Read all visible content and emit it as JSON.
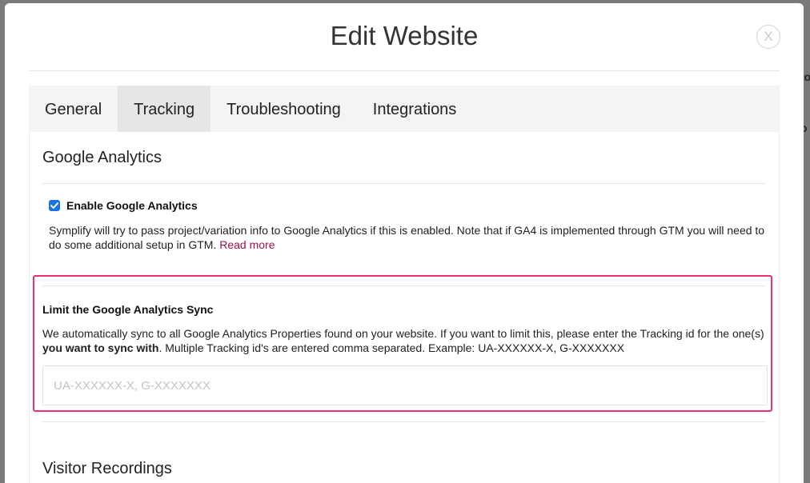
{
  "backdrop": {
    "partial_text_1": "to",
    "partial_text_2": "o"
  },
  "modal": {
    "title": "Edit Website",
    "close_label": "X"
  },
  "tabs": [
    {
      "label": "General",
      "active": false
    },
    {
      "label": "Tracking",
      "active": true
    },
    {
      "label": "Troubleshooting",
      "active": false
    },
    {
      "label": "Integrations",
      "active": false
    }
  ],
  "google_analytics": {
    "section_title": "Google Analytics",
    "enable_checkbox": {
      "label": "Enable Google Analytics",
      "checked": true
    },
    "description": "Symplify will try to pass project/variation info to Google Analytics if this is enabled. Note that if GA4 is implemented through GTM you will need to do some additional setup in GTM. ",
    "read_more_link": "Read more"
  },
  "limit_sync": {
    "title": "Limit the Google Analytics Sync",
    "description_part1": "We automatically sync to all Google Analytics Properties found on your website. If you want to limit this, please enter the Tracking id for the one(s) ",
    "description_bold": "you want to sync with",
    "description_part2": ". Multiple Tracking id's are entered comma separated. Example: UA-XXXXXX-X, G-XXXXXXX",
    "input_value": "",
    "input_placeholder": "UA-XXXXXX-X, G-XXXXXXX"
  },
  "visitor_recordings": {
    "section_title": "Visitor Recordings"
  },
  "colors": {
    "highlight_border": "#e8336f",
    "link": "#a0114e",
    "checkbox": "#1a73e8",
    "active_tab": "#e6e6e6"
  }
}
